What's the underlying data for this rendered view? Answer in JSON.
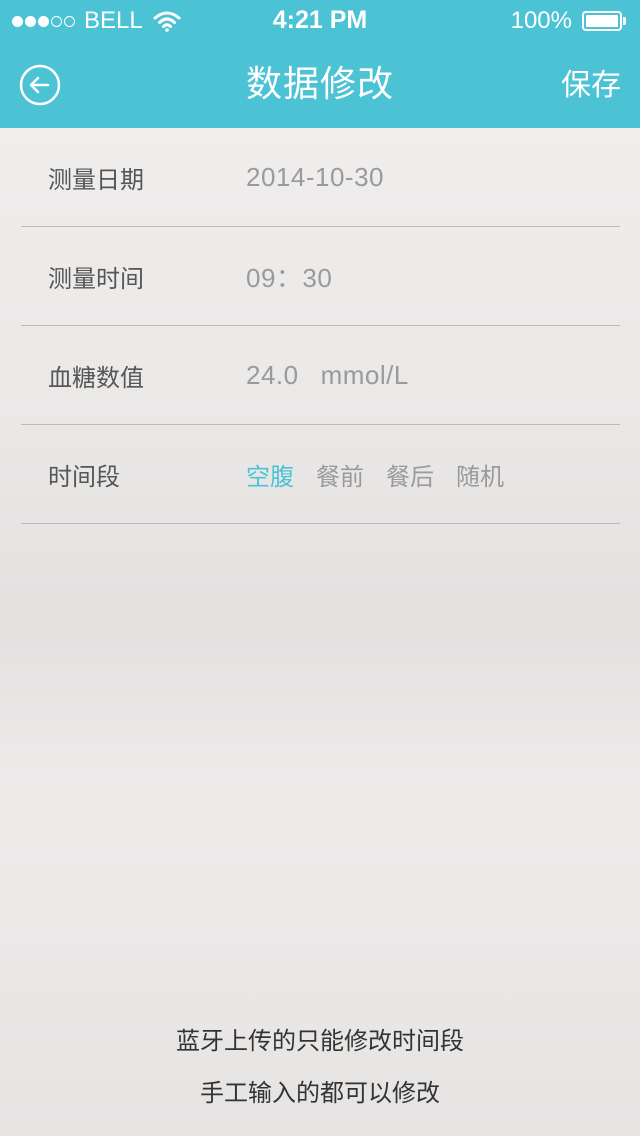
{
  "status_bar": {
    "carrier": "BELL",
    "time": "4:21 PM",
    "battery": "100%"
  },
  "header": {
    "title": "数据修改",
    "save_label": "保存",
    "back_icon": "arrow-left-circle-icon",
    "background_color": "#4cc2d5"
  },
  "form": {
    "date_label": "测量日期",
    "date_value": "2014-10-30",
    "time_label": "测量时间",
    "time_value": "09：30",
    "glucose_label": "血糖数值",
    "glucose_value": "24.0",
    "glucose_unit": "mmol/L",
    "period_label": "时间段",
    "period_options": [
      "空腹",
      "餐前",
      "餐后",
      "随机"
    ],
    "period_selected": "空腹"
  },
  "footer": {
    "line1": "蓝牙上传的只能修改时间段",
    "line2": "手工输入的都可以修改"
  },
  "colors": {
    "accent": "#4cc2d5",
    "label_text": "#565656",
    "value_text": "#9a9a9a"
  }
}
